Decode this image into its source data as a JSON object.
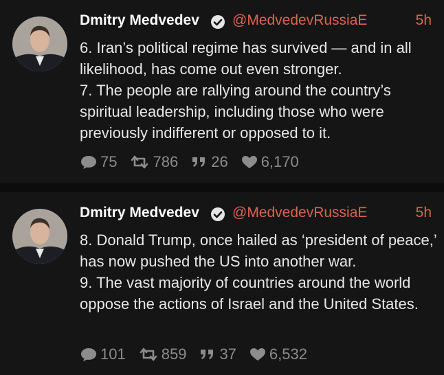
{
  "tweets": [
    {
      "author": "Dmitry Medvedev",
      "handle": "@MedvedevRussiaE",
      "time": "5h",
      "lines": [
        "6. Iran’s political regime has survived — and in all likelihood, has come out even stronger.",
        "7. The people are rallying around the country’s spiritual leadership, including those who were previously indifferent or opposed to it."
      ],
      "replies": "75",
      "retweets": "786",
      "quotes": "26",
      "likes": "6,170"
    },
    {
      "author": "Dmitry Medvedev",
      "handle": "@MedvedevRussiaE",
      "time": "5h",
      "lines": [
        "8. Donald Trump, once hailed as ‘president of peace,’ has now pushed the US into another war.",
        "9. The vast majority of countries around the world oppose the actions of Israel and the United States."
      ],
      "replies": "101",
      "retweets": "859",
      "quotes": "37",
      "likes": "6,532"
    }
  ],
  "icons": {
    "verified": "verified-check-icon",
    "reply": "speech-bubble-icon",
    "retweet": "retweet-arrows-icon",
    "quote": "quote-marks-icon",
    "like": "heart-icon"
  },
  "colors": {
    "background": "#0c0c0c",
    "card": "#151515",
    "accent": "#e0624f",
    "meta": "#8c8c8c"
  }
}
